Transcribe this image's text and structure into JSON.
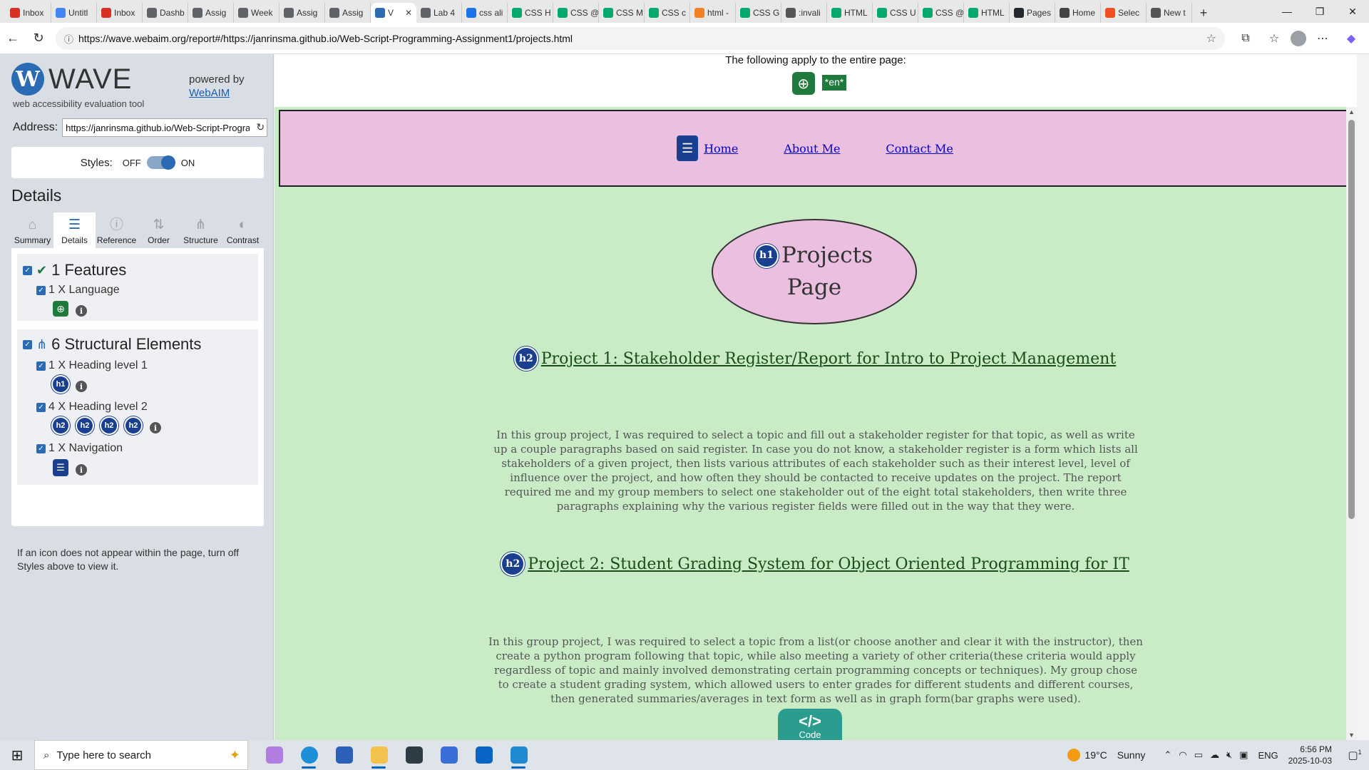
{
  "browser": {
    "tabs": [
      {
        "label": "Inbox",
        "icon": "gmail-icon",
        "color": "#d93025"
      },
      {
        "label": "Untitl",
        "icon": "docs-icon",
        "color": "#4285f4"
      },
      {
        "label": "Inbox",
        "icon": "gmail-icon",
        "color": "#d93025"
      },
      {
        "label": "Dashb",
        "icon": "link-icon",
        "color": "#5f6368"
      },
      {
        "label": "Assig",
        "icon": "link-icon",
        "color": "#5f6368"
      },
      {
        "label": "Week",
        "icon": "link-icon",
        "color": "#5f6368"
      },
      {
        "label": "Assig",
        "icon": "link-icon",
        "color": "#5f6368"
      },
      {
        "label": "Assig",
        "icon": "link-icon",
        "color": "#5f6368"
      },
      {
        "label": "V",
        "icon": "wave-icon",
        "color": "#2a6bb3",
        "active": true
      },
      {
        "label": "Lab 4",
        "icon": "link-icon",
        "color": "#5f6368"
      },
      {
        "label": "css ali",
        "icon": "search-icon",
        "color": "#1a73e8"
      },
      {
        "label": "CSS H",
        "icon": "w3-icon",
        "color": "#04aa6d"
      },
      {
        "label": "CSS @",
        "icon": "w3-icon",
        "color": "#04aa6d"
      },
      {
        "label": "CSS M",
        "icon": "w3-icon",
        "color": "#04aa6d"
      },
      {
        "label": "CSS c",
        "icon": "w3-icon",
        "color": "#04aa6d"
      },
      {
        "label": "html -",
        "icon": "so-icon",
        "color": "#f48024"
      },
      {
        "label": "CSS G",
        "icon": "w3-icon",
        "color": "#04aa6d"
      },
      {
        "label": ":invali",
        "icon": "mdn-icon",
        "color": "#555555"
      },
      {
        "label": "HTML",
        "icon": "w3-icon",
        "color": "#04aa6d"
      },
      {
        "label": "CSS U",
        "icon": "w3-icon",
        "color": "#04aa6d"
      },
      {
        "label": "CSS @",
        "icon": "w3-icon",
        "color": "#04aa6d"
      },
      {
        "label": "HTML",
        "icon": "w3-icon",
        "color": "#04aa6d"
      },
      {
        "label": "Pages",
        "icon": "github-icon",
        "color": "#24292f"
      },
      {
        "label": "Home",
        "icon": "globe-icon",
        "color": "#444444"
      },
      {
        "label": "Selec",
        "icon": "ms-icon",
        "color": "#f25022"
      },
      {
        "label": "New t",
        "icon": "newtab-icon",
        "color": "#555555"
      }
    ],
    "url": "https://wave.webaim.org/report#/https://janrinsma.github.io/Web-Script-Programming-Assignment1/projects.html"
  },
  "wave": {
    "logo_text": "WAVE",
    "tagline": "web accessibility evaluation tool",
    "powered_by": "powered by",
    "webaim_link": "WebAIM",
    "address_label": "Address:",
    "address_value": "https://janrinsma.github.io/Web-Script-Programming-Assignment1/projects.html",
    "styles_label": "Styles:",
    "styles_off": "OFF",
    "styles_on": "ON",
    "details_title": "Details",
    "tabs": [
      "Summary",
      "Details",
      "Reference",
      "Order",
      "Structure",
      "Contrast"
    ],
    "features_title": "1 Features",
    "language_item": "1 X Language",
    "structural_title": "6 Structural Elements",
    "h1_item": "1 X Heading level 1",
    "h2_item": "4 X Heading level 2",
    "nav_item": "1 X Navigation",
    "h1_badge": "h1",
    "h2_badge": "h2",
    "note": "If an icon does not appear within the page, turn off Styles above to view it."
  },
  "page": {
    "applies_note": "The following apply to the entire page:",
    "lang_tag": "*en*",
    "nav": [
      "Home",
      "About Me",
      "Contact Me"
    ],
    "title_line1": "Projects",
    "title_line2": "Page",
    "project1_heading": "Project 1: Stakeholder Register/Report for Intro to Project Management",
    "project1_body": "In this group project, I was required to select a topic and fill out a stakeholder register for that topic, as well as write up a couple paragraphs based on said register. In case you do not know, a stakeholder register is a form which lists all stakeholders of a given project, then lists various attributes of each stakeholder such as their interest level, level of influence over the project, and how often they should be contacted to receive updates on the project. The report required me and my group members to select one stakeholder out of the eight total stakeholders, then write three paragraphs explaining why the various register fields were filled out in the way that they were.",
    "project2_heading": "Project 2: Student Grading System for Object Oriented Programming for IT",
    "project2_body": "In this group project, I was required to select a topic from a list(or choose another and clear it with the instructor), then create a python program following that topic, while also meeting a variety of other criteria(these criteria would apply regardless of topic and mainly involved demonstrating certain programming concepts or techniques). My group chose to create a student grading system, which allowed users to enter grades for different students and different courses, then generated summaries/averages in text form as well as in graph form(bar graphs were used).",
    "code_glyph": "</>",
    "code_label": "Code"
  },
  "taskbar": {
    "search_placeholder": "Type here to search",
    "weather_temp": "19°C",
    "weather_desc": "Sunny",
    "lang": "ENG",
    "time": "6:56 PM",
    "date": "2025-10-03",
    "notif_count": "1"
  },
  "colors": {
    "site_background": "#c9ecc7",
    "nav_background": "#ebbfe0",
    "wave_blue": "#2a6bb3",
    "heading_badge": "#1a3f8f",
    "feature_green": "#1f7a3c"
  }
}
